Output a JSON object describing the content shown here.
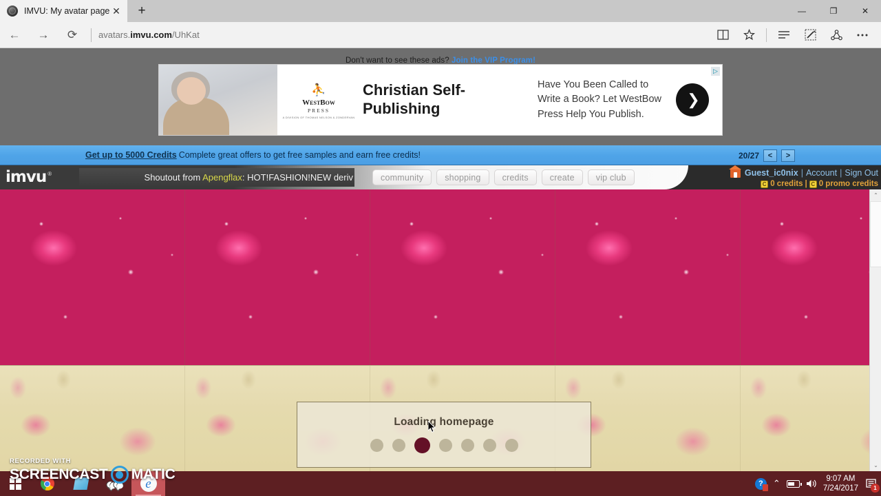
{
  "browser": {
    "tab": {
      "title": "IMVU: My avatar page:",
      "favicon": "imvu-favicon",
      "close": "✕"
    },
    "new_tab": "+",
    "window_controls": {
      "minimize": "—",
      "restore": "❐",
      "close": "✕"
    },
    "nav": {
      "back": "←",
      "forward": "→",
      "refresh": "⟳"
    },
    "address": {
      "prefix": "avatars.",
      "domain": "imvu.com",
      "path": "/UhKat"
    },
    "toolbar_icons": [
      "reading-view-icon",
      "favorites-star-icon",
      "hub-icon",
      "web-note-icon",
      "share-icon",
      "more-icon"
    ]
  },
  "ad": {
    "nag_text": "Don't want to see these ads?",
    "nag_link": "Join the VIP Program!",
    "brand_mark": "⛹",
    "brand_name": "WestBow",
    "brand_sub": "PRESS",
    "brand_fine": "A DIVISION OF THOMAS NELSON & ZONDERVAN",
    "headline": "Christian Self-Publishing",
    "copy": "Have You Been Called to Write a Book? Let WestBow Press Help You Publish.",
    "cta": "❯",
    "adchoices": "▷"
  },
  "creditbar": {
    "link": "Get up to 5000 Credits",
    "message": "Complete great offers to get free samples and earn free credits!",
    "counter": "20/27",
    "prev": "<",
    "next": ">"
  },
  "imvunav": {
    "logo": "imvu",
    "logo_reg": "®",
    "shoutout_prefix": "Shoutout from ",
    "shoutout_user": "Apengflax",
    "shoutout_suffix": ": HOT!FASHION!NEW deriv",
    "items": [
      {
        "label": "community"
      },
      {
        "label": "shopping"
      },
      {
        "label": "credits"
      },
      {
        "label": "create"
      },
      {
        "label": "vip club"
      }
    ],
    "account": {
      "name": "Guest_ic0nix",
      "sep1": "|",
      "account_link": "Account",
      "sep2": "|",
      "signout_link": "Sign Out",
      "coin_symbol": "C",
      "credits": "0 credits",
      "credits_sep": "|",
      "promo_credits": "0 promo credits"
    }
  },
  "room": {
    "loading_text": "Loading homepage",
    "dots_total": 7,
    "active_dot_index": 2,
    "scrollbar": {
      "up": "⌃",
      "down": "⌄"
    }
  },
  "watermark": {
    "line1": "RECORDED WITH",
    "word1": "SCREENCAST",
    "word2": "MATIC"
  },
  "taskbar": {
    "start": "windows-start-icon",
    "items": [
      {
        "name": "chrome-taskbar-icon"
      },
      {
        "name": "store-taskbar-icon"
      },
      {
        "name": "imvu-taskbar-icon"
      },
      {
        "name": "edge-taskbar-icon",
        "active": true
      }
    ],
    "tray": {
      "help": "?",
      "chevron": "⌃",
      "volume": "🔊",
      "time": "9:07 AM",
      "date": "7/24/2017",
      "notification_count": "1"
    }
  },
  "colors": {
    "accent_blue": "#4fa4e8",
    "taskbar": "#5d1f22",
    "rose_pink": "#e0357a",
    "wallpaper_cream": "#ddd4a8",
    "loading_dot_active": "#641127"
  }
}
